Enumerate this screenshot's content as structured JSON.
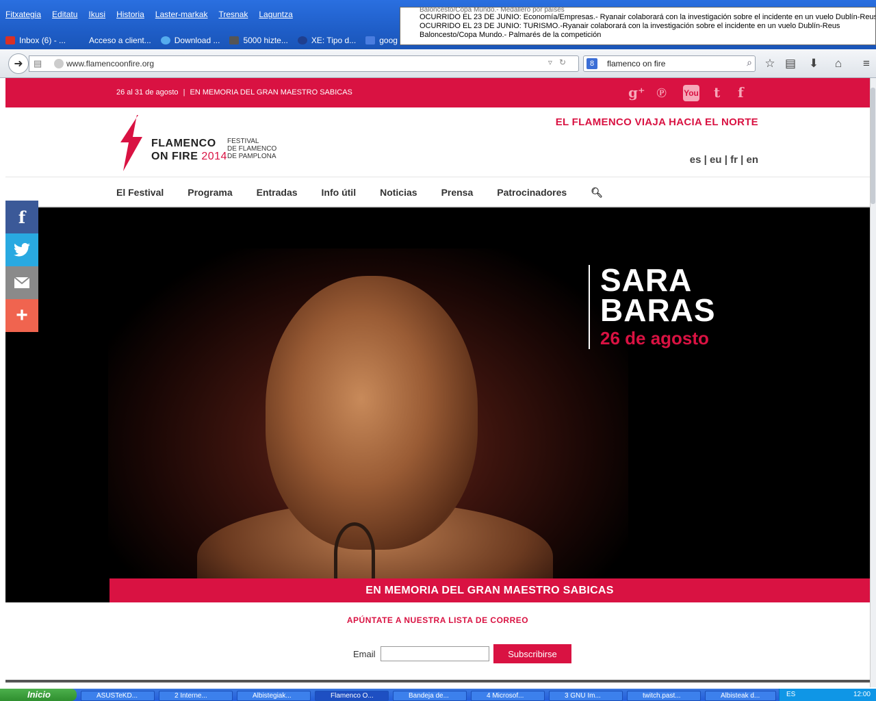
{
  "menubar": [
    "Fitxategia",
    "Editatu",
    "Ikusi",
    "Historia",
    "Laster-markak",
    "Tresnak",
    "Laguntza"
  ],
  "bookmarks": [
    {
      "label": "Inbox (6) - ...",
      "icon": "gmail-icon",
      "color": "#d93025"
    },
    {
      "label": "Acceso a client...",
      "icon": "bookmark-icon",
      "color": "#3c6bd6"
    },
    {
      "label": "Download ...",
      "icon": "twitter-icon",
      "color": "#55acee"
    },
    {
      "label": "5000 hizte...",
      "icon": "page-icon",
      "color": "#555555"
    },
    {
      "label": "XE: Tipo d...",
      "icon": "xe-icon",
      "color": "#1f3f8f"
    },
    {
      "label": "goog",
      "icon": "google-icon",
      "color": "#4a7de0"
    }
  ],
  "ticker": [
    "Baloncesto/Copa Mundo.- Medallero por países",
    "OCURRIDO EL 23 DE JUNIO: Economía/Empresas.- Ryanair colaborará con la investigación sobre el incidente en un vuelo Dublín-Reus",
    "OCURRIDO EL 23 DE JUNIO: TURISMO.-Ryanair colaborará con la investigación sobre el incidente en un vuelo Dublín-Reus",
    "Baloncesto/Copa Mundo.- Palmarés de la competición"
  ],
  "browser": {
    "url": "www.flamencoonfire.org",
    "search_value": "flamenco on fire"
  },
  "site": {
    "topstrip": {
      "dates": "26 al 31 de agosto",
      "separator": "|",
      "memoriam": "EN MEMORIA DEL GRAN MAESTRO SABICAS"
    },
    "social": [
      {
        "icon": "google-plus-icon",
        "glyph": "g⁺"
      },
      {
        "icon": "pinterest-icon",
        "glyph": "℗"
      },
      {
        "icon": "youtube-icon",
        "glyph": "▶"
      },
      {
        "icon": "twitter-icon",
        "glyph": "t"
      },
      {
        "icon": "facebook-icon",
        "glyph": "f"
      }
    ],
    "brand": {
      "line1": "FLAMENCO",
      "line2": "ON FIRE",
      "year": "2014",
      "sub1": "FESTIVAL",
      "sub2": "DE FLAMENCO",
      "sub3": "DE PAMPLONA"
    },
    "slogan": "EL FLAMENCO VIAJA HACIA EL NORTE",
    "langs": [
      "es",
      "eu",
      "fr",
      "en"
    ],
    "nav": [
      "El Festival",
      "Programa",
      "Entradas",
      "Info útil",
      "Noticias",
      "Prensa",
      "Patrocinadores"
    ],
    "hero": {
      "name1": "SARA",
      "name2": "BARAS",
      "date": "26 de agosto"
    },
    "share": [
      {
        "icon": "facebook-icon",
        "glyph": "f",
        "color": "#3b5998"
      },
      {
        "icon": "twitter-icon",
        "glyph": "🐦",
        "color": "#29a9e1"
      },
      {
        "icon": "email-icon",
        "glyph": "✉",
        "color": "#8a8a8a"
      },
      {
        "icon": "plus-icon",
        "glyph": "+",
        "color": "#f0644f"
      }
    ],
    "memoriam_banner": "EN MEMORIA DEL GRAN MAESTRO SABICAS",
    "mailing": {
      "title": "APÚNTATE A NUESTRA LISTA DE CORREO",
      "email_label": "Email",
      "email_value": "",
      "subscribe_label": "Subscribirse"
    },
    "accent_color": "#d91242"
  },
  "taskbar": {
    "start_label": "Inicio",
    "tasks": [
      "ASUSTeKD...",
      "2 Interne...",
      "Albistegiak...",
      "Flamenco O...",
      "Bandeja de...",
      "4 Microsof...",
      "3 GNU Im...",
      "twitch.past...",
      "Albisteak d..."
    ],
    "active_task": 3,
    "lang": "ES",
    "clock": "12:00"
  }
}
